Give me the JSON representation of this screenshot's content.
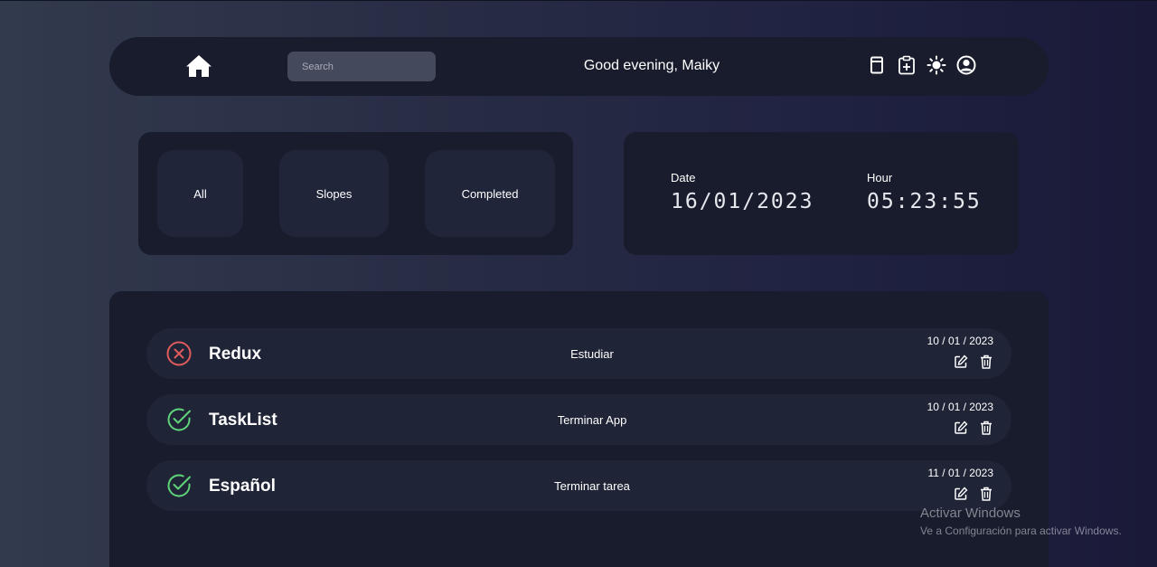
{
  "nav": {
    "search_placeholder": "Search",
    "greeting": "Good evening, Maiky",
    "icons": [
      "home-icon",
      "book-icon",
      "clipboard-plus-icon",
      "sun-icon",
      "user-circle-icon"
    ]
  },
  "filters": {
    "all": "All",
    "slopes": "Slopes",
    "completed": "Completed"
  },
  "clock": {
    "date_label": "Date",
    "date_value": "16/01/2023",
    "hour_label": "Hour",
    "hour_value": "05:23:55"
  },
  "tasks": [
    {
      "title": "Redux",
      "description": "Estudiar",
      "date": "10 / 01 / 2023",
      "status": "pending"
    },
    {
      "title": "TaskList",
      "description": "Terminar App",
      "date": "10 / 01 / 2023",
      "status": "completed"
    },
    {
      "title": "Español",
      "description": "Terminar tarea",
      "date": "11 / 01 / 2023",
      "status": "completed"
    }
  ],
  "colors": {
    "pending": "#e05b5b",
    "completed": "#5fd47a",
    "card": "#181c2c",
    "row": "#1f2436"
  },
  "watermark": {
    "title": "Activar Windows",
    "subtitle": "Ve a Configuración para activar Windows."
  }
}
